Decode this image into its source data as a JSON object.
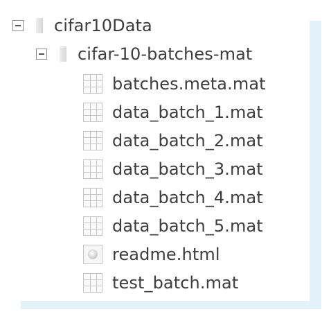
{
  "tree": {
    "root": {
      "label": "cifar10Data",
      "toggle_icon": "minus-box-icon",
      "icon": "folder-icon"
    },
    "subfolder": {
      "label": "cifar-10-batches-mat",
      "toggle_icon": "minus-box-icon",
      "icon": "folder-icon"
    },
    "files": [
      {
        "label": "batches.meta.mat",
        "icon": "mat-file-icon"
      },
      {
        "label": "data_batch_1.mat",
        "icon": "mat-file-icon"
      },
      {
        "label": "data_batch_2.mat",
        "icon": "mat-file-icon"
      },
      {
        "label": "data_batch_3.mat",
        "icon": "mat-file-icon"
      },
      {
        "label": "data_batch_4.mat",
        "icon": "mat-file-icon"
      },
      {
        "label": "data_batch_5.mat",
        "icon": "mat-file-icon"
      },
      {
        "label": "readme.html",
        "icon": "html-file-icon"
      },
      {
        "label": "test_batch.mat",
        "icon": "mat-file-icon"
      }
    ]
  },
  "colors": {
    "scroll_strip": "#e3f1fb",
    "text": "#3d3d3d",
    "icon_border": "#c4c4c4"
  }
}
